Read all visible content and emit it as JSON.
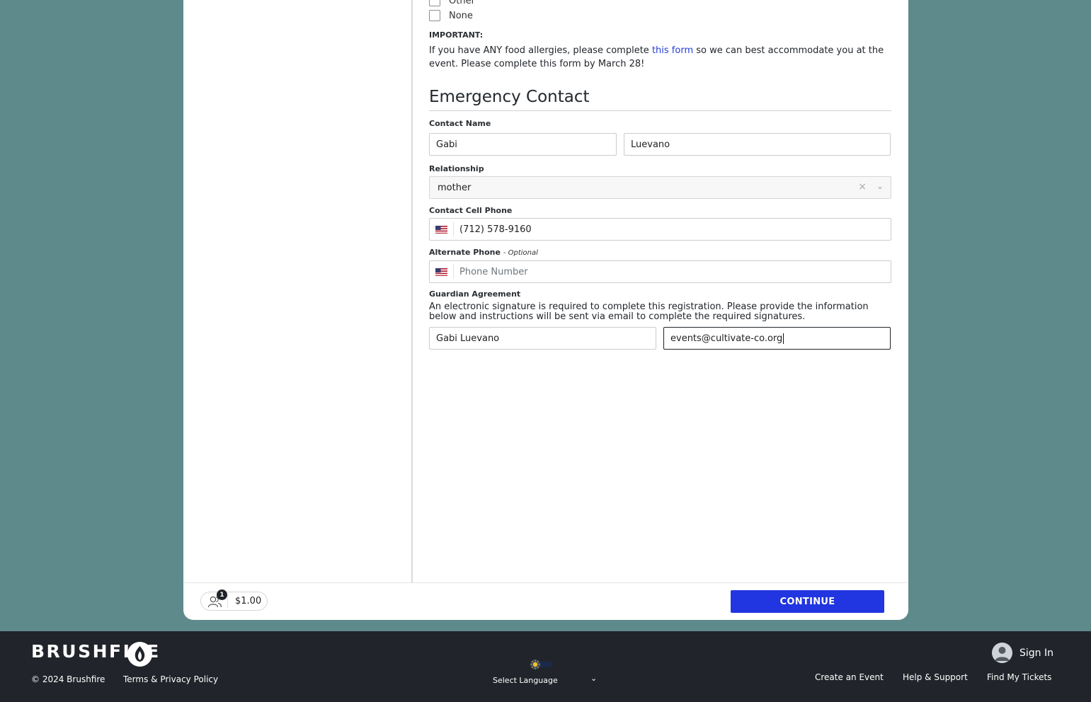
{
  "diet": {
    "options": [
      {
        "label": "Other",
        "checked": false
      },
      {
        "label": "None",
        "checked": false
      }
    ]
  },
  "notice": {
    "heading": "IMPORTANT:",
    "text_before": "If you have ANY food allergies, please complete ",
    "link": "this form",
    "text_after": " so we can best accommodate you at the event. Please complete this form by March 28!"
  },
  "emergency": {
    "title": "Emergency Contact",
    "contact_name_label": "Contact Name",
    "first_name": "Gabi",
    "last_name": "Luevano",
    "relationship_label": "Relationship",
    "relationship_value": "mother",
    "cell_label": "Contact Cell Phone",
    "cell_value": "(712) 578-9160",
    "alt_label": "Alternate Phone",
    "alt_optional": "- Optional",
    "alt_placeholder": "Phone Number"
  },
  "guardian": {
    "label": "Guardian Agreement",
    "description": "An electronic signature is required to complete this registration. Please provide the information below and instructions will be sent via email to complete the required signatures.",
    "name_value": "Gabi Luevano",
    "email_value": "events@cultivate-co.org"
  },
  "cart": {
    "count": "1",
    "total": "$1.00"
  },
  "actions": {
    "continue_label": "CONTINUE"
  },
  "footer": {
    "brand": "BRUSHFIRE",
    "copyright": "© 2024 Brushfire",
    "terms": "Terms & Privacy Policy",
    "language": "Select Language",
    "sign_in": "Sign In",
    "links": [
      "Create an Event",
      "Help & Support",
      "Find My Tickets"
    ]
  },
  "colors": {
    "background": "#5e8a8c",
    "accent": "#2135e0",
    "link": "#2440d8",
    "footer": "#21242a"
  }
}
